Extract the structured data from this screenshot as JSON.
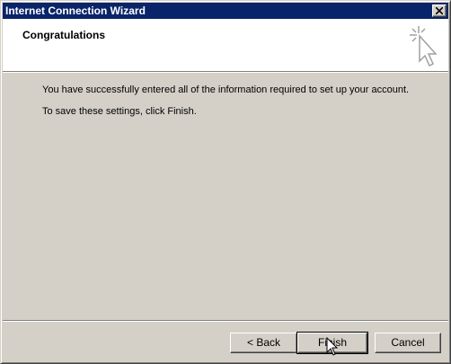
{
  "window": {
    "title": "Internet Connection Wizard",
    "close_icon": "close-icon"
  },
  "header": {
    "title": "Congratulations",
    "icon": "wizard-star-cursor-icon"
  },
  "content": {
    "message_1": "You have successfully entered all of the information required to set up your account.",
    "message_2": "To save these settings, click Finish."
  },
  "buttons": {
    "back_label": "< Back",
    "finish_label": "Finish",
    "cancel_label": "Cancel"
  },
  "colors": {
    "titlebar": "#0a246a",
    "face": "#d4d0c8",
    "header_bg": "#ffffff"
  }
}
